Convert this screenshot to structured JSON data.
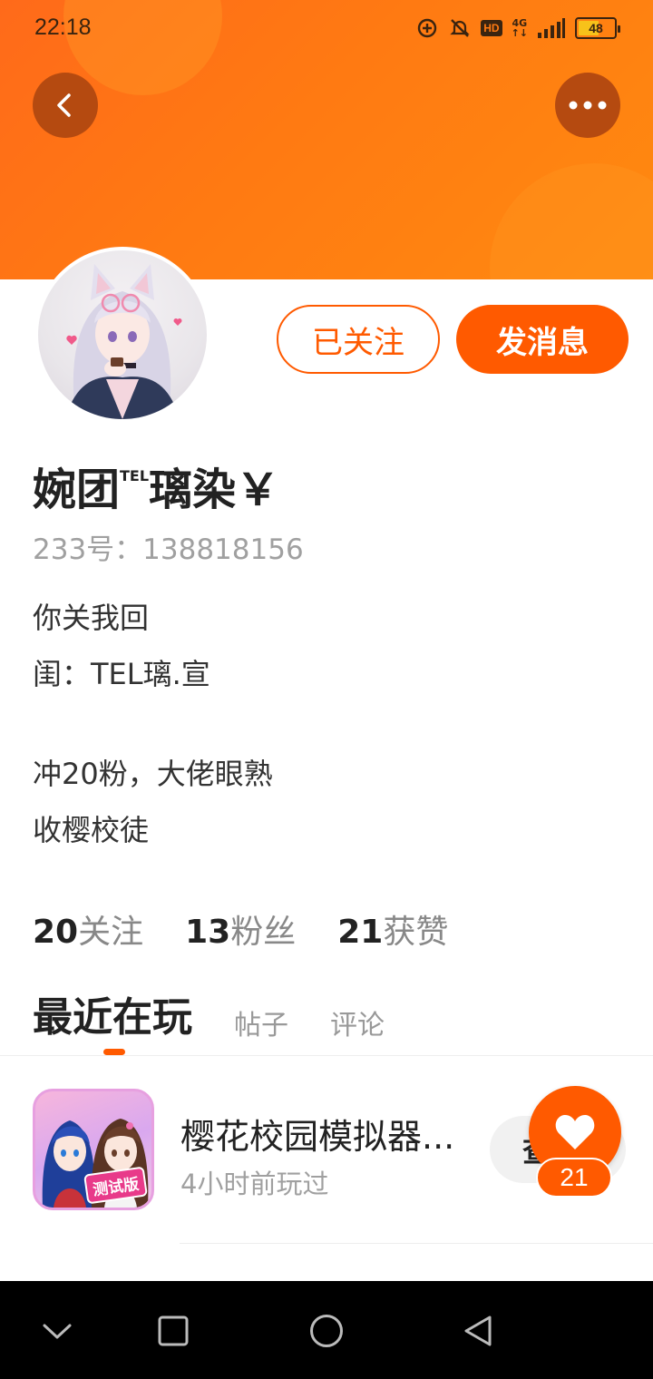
{
  "status_bar": {
    "time": "22:18",
    "hd_label": "HD",
    "network_label": "4G",
    "battery_level": "48"
  },
  "header": {
    "back_icon": "chevron-left-icon",
    "more_icon": "more-horizontal-icon",
    "accent_color": "#ff5a00"
  },
  "profile": {
    "follow_label": "已关注",
    "message_label": "发消息",
    "name_prefix": "婉团",
    "name_sup": "TEL",
    "name_suffix": "璃染￥",
    "user_id": "233号：138818156",
    "bio_lines": [
      "你关我回",
      "闺：TEL璃.宣",
      "",
      "冲20粉，大佬眼熟",
      "收樱校徒"
    ],
    "stats": [
      {
        "num": "20",
        "label": "关注"
      },
      {
        "num": "13",
        "label": "粉丝"
      },
      {
        "num": "21",
        "label": "获赞"
      }
    ]
  },
  "tabs": [
    {
      "label": "最近在玩",
      "active": true
    },
    {
      "label": "帖子",
      "active": false
    },
    {
      "label": "评论",
      "active": false
    }
  ],
  "games": [
    {
      "title": "樱花校园模拟器...",
      "subtitle": "4小时前玩过",
      "badge": "测试版",
      "action_label": "查"
    }
  ],
  "like_fab": {
    "count": "21"
  }
}
